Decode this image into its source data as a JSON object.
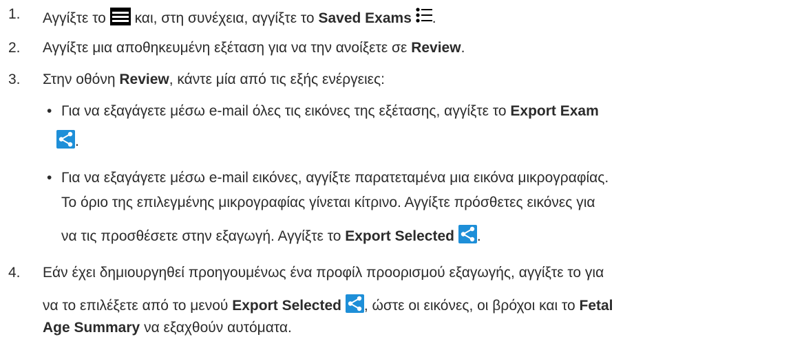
{
  "steps": [
    {
      "num": "1.",
      "t1": "Αγγίξτε το",
      "t2": "και, στη συνέχεια, αγγίξτε το",
      "b1": "Saved Exams",
      "t3": "."
    },
    {
      "num": "2.",
      "t1": "Αγγίξτε μια αποθηκευμένη εξέταση για να την ανοίξετε σε",
      "b1": "Review",
      "t2": "."
    },
    {
      "num": "3.",
      "t1": "Στην οθόνη",
      "b1": "Review",
      "t2": ", κάντε μία από τις εξής ενέργειες:"
    },
    {
      "num": "4.",
      "line1": "Εάν έχει δημιουργηθεί προηγουμένως ένα προφίλ προορισμού εξαγωγής, αγγίξτε το για",
      "line2a": "να το επιλέξετε από το μενού",
      "b1": "Export Selected",
      "line2b": ", ώστε οι εικόνες, οι βρόχοι και το",
      "b2": "Fetal",
      "b3": "Age Summary",
      "line3b": "να εξαχθούν αυτόματα."
    }
  ],
  "bullets": [
    {
      "dot": "•",
      "t1": "Για να εξαγάγετε μέσω e-mail όλες τις εικόνες της εξέτασης, αγγίξτε το",
      "b1": "Export Exam",
      "t2": "."
    },
    {
      "dot": "•",
      "line1": "Για να εξαγάγετε μέσω e-mail εικόνες, αγγίξτε παρατεταμένα μια εικόνα μικρογραφίας.",
      "line2": "Το όριο της επιλεγμένης μικρογραφίας γίνεται κίτρινο. Αγγίξτε πρόσθετες εικόνες για",
      "line3a": "να τις προσθέσετε στην εξαγωγή. Αγγίξτε το",
      "b1": "Export Selected",
      "t2": "."
    }
  ],
  "icons": {
    "menu": "hamburger-menu-icon",
    "list": "list-icon",
    "share": "share-icon",
    "share_color": "#1e8fd8",
    "menu_color": "#000000"
  }
}
